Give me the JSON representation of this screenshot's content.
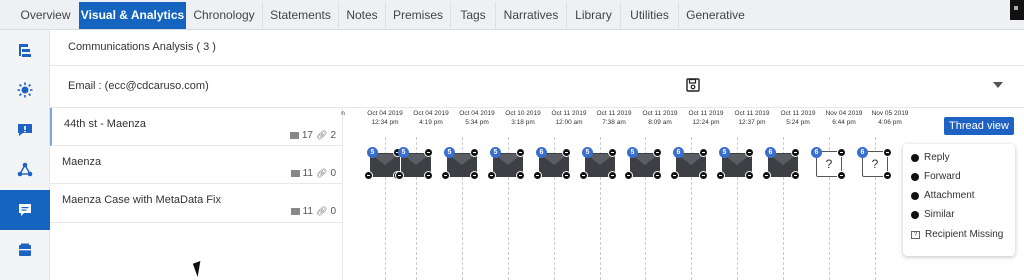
{
  "tabs": [
    {
      "label": "Overview",
      "active": false
    },
    {
      "label": "Visual & Analytics",
      "active": true
    },
    {
      "label": "Chronology",
      "active": false
    },
    {
      "label": "Statements",
      "active": false
    },
    {
      "label": "Notes",
      "active": false
    },
    {
      "label": "Premises",
      "active": false
    },
    {
      "label": "Tags",
      "active": false
    },
    {
      "label": "Narratives",
      "active": false
    },
    {
      "label": "Library",
      "active": false
    },
    {
      "label": "Utilities",
      "active": false
    },
    {
      "label": "Generative",
      "active": false
    }
  ],
  "rail": [
    {
      "icon": "hierarchy-icon",
      "active": false
    },
    {
      "icon": "sun-network-icon",
      "active": false
    },
    {
      "icon": "chat-alert-icon",
      "active": false
    },
    {
      "icon": "connections-icon",
      "active": false
    },
    {
      "icon": "message-icon",
      "active": true
    },
    {
      "icon": "folder-icon",
      "active": false
    }
  ],
  "panel": {
    "title": "Communications Analysis ( 3 )",
    "email": "Email : (ecc@cdcaruso.com)"
  },
  "threads": [
    {
      "title": "44th st - Maenza",
      "messages": "17",
      "attachments": "2",
      "selected": true
    },
    {
      "title": "Maenza",
      "messages": "11",
      "attachments": "0",
      "selected": false
    },
    {
      "title": "Maenza Case with MetaData Fix",
      "messages": "11",
      "attachments": "0",
      "selected": false
    }
  ],
  "timeline": {
    "dates": [
      {
        "date": "",
        "time": "n",
        "partial": true
      },
      {
        "date": "Oct 04 2019",
        "time": "12:34 pm"
      },
      {
        "date": "Oct 04 2019",
        "time": "4:19 pm"
      },
      {
        "date": "Oct 04 2019",
        "time": "5:34 pm"
      },
      {
        "date": "Oct 10 2019",
        "time": "3:18 pm"
      },
      {
        "date": "Oct 11 2019",
        "time": "12:00 am"
      },
      {
        "date": "Oct 11 2019",
        "time": "7:38 am"
      },
      {
        "date": "Oct 11 2019",
        "time": "8:09 am"
      },
      {
        "date": "Oct 11 2019",
        "time": "12:24 pm"
      },
      {
        "date": "Oct 11 2019",
        "time": "12:37 pm"
      },
      {
        "date": "Oct 11 2019",
        "time": "5:24 pm"
      },
      {
        "date": "Nov 04 2019",
        "time": "6:44 pm"
      },
      {
        "date": "Nov 05 2019",
        "time": "4:06 pm"
      }
    ],
    "messages": [
      {
        "badge": "5",
        "type": "envelope"
      },
      {
        "badge": "5",
        "type": "envelope"
      },
      {
        "badge": "5",
        "type": "envelope"
      },
      {
        "badge": "5",
        "type": "envelope"
      },
      {
        "badge": "6",
        "type": "envelope"
      },
      {
        "badge": "5",
        "type": "envelope"
      },
      {
        "badge": "5",
        "type": "envelope"
      },
      {
        "badge": "6",
        "type": "envelope"
      },
      {
        "badge": "5",
        "type": "envelope"
      },
      {
        "badge": "6",
        "type": "envelope"
      },
      {
        "badge": "6",
        "type": "missing",
        "glyph": "?"
      },
      {
        "badge": "6",
        "type": "missing",
        "glyph": "?"
      }
    ],
    "thread_view_label": "Thread view"
  },
  "legend": [
    {
      "label": "Reply",
      "icon": "reply-icon"
    },
    {
      "label": "Forward",
      "icon": "forward-icon"
    },
    {
      "label": "Attachment",
      "icon": "attachment-icon"
    },
    {
      "label": "Similar",
      "icon": "similar-icon"
    },
    {
      "label": "Recipient Missing",
      "icon": "recipient-missing-icon",
      "glyph": "?"
    }
  ],
  "colors": {
    "accent": "#1565c0",
    "badge": "#3a6fd0",
    "envelope": "#3d3f44"
  }
}
